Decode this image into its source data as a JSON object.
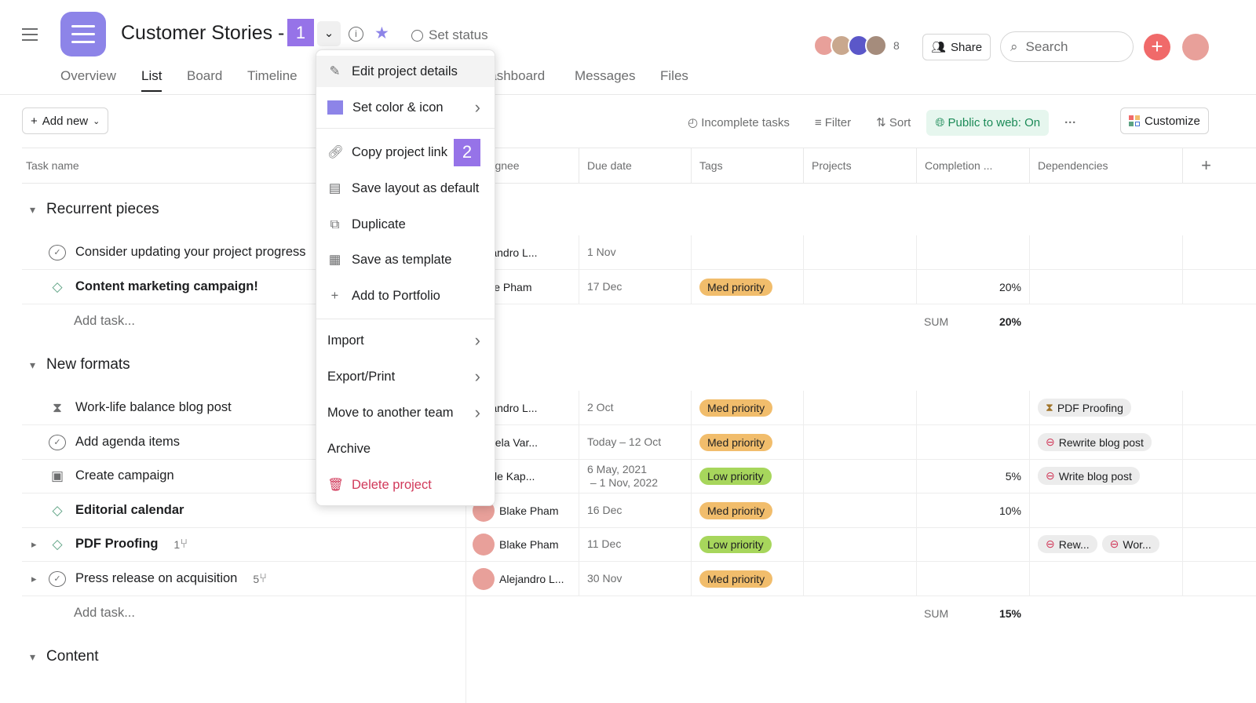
{
  "header": {
    "title": "Customer Stories - ",
    "badge1": "1",
    "set_status": "Set status",
    "member_count": "8",
    "share": "Share",
    "search_placeholder": "Search"
  },
  "tabs": [
    "Overview",
    "List",
    "Board",
    "Timeline",
    "Dashboard",
    "Messages",
    "Files"
  ],
  "toolbar": {
    "add_new": "Add new",
    "incomplete": "Incomplete tasks",
    "filter": "Filter",
    "sort": "Sort",
    "public": "Public to web: On",
    "more": "···",
    "customize": "Customize"
  },
  "columns": [
    "Task name",
    "Assignee",
    "Due date",
    "Tags",
    "Projects",
    "Completion ...",
    "Dependencies",
    "+"
  ],
  "colors": {
    "accent": "#8d84e8",
    "med": "#f1bd6c",
    "low": "#a7d65c",
    "public_bg": "#e6f6ee",
    "public_fg": "#1b8a57",
    "add_btn": "#f06a6a",
    "danger": "#d1395a"
  },
  "sections": [
    {
      "name": "Recurrent pieces",
      "rows": [
        {
          "icon": "check",
          "name": "Consider updating your project progress",
          "bold": false,
          "assignee": "Alejandro L...",
          "due": "1 Nov",
          "tag": "",
          "completion": "",
          "deps": []
        },
        {
          "icon": "diamond",
          "name": "Content marketing campaign!",
          "bold": true,
          "assignee": "Blake Pham",
          "due": "17 Dec",
          "tag": "Med priority",
          "completion": "20%",
          "deps": []
        }
      ],
      "add_task": "Add task...",
      "sum_label": "SUM",
      "sum": "20%"
    },
    {
      "name": "New formats",
      "rows": [
        {
          "icon": "hourglass",
          "name": "Work-life balance blog post",
          "bold": false,
          "assignee": "Alejandro L...",
          "due": "2 Oct",
          "tag": "Med priority",
          "completion": "",
          "deps": [
            {
              "icon": "hourglass",
              "label": "PDF Proofing"
            }
          ]
        },
        {
          "icon": "check",
          "name": "Add agenda items",
          "bold": false,
          "assignee": "Daniela Var...",
          "due": "Today – 12 Oct",
          "tag": "Med priority",
          "completion": "",
          "deps": [
            {
              "icon": "blocked",
              "label": "Rewrite blog post"
            }
          ]
        },
        {
          "icon": "approval",
          "name": "Create campaign",
          "bold": false,
          "assignee": "Nicole Kap...",
          "due": "6 May, 2021\n – 1 Nov, 2022",
          "tag": "Low priority",
          "completion": "5%",
          "deps": [
            {
              "icon": "blocked",
              "label": "Write blog post"
            }
          ]
        },
        {
          "icon": "diamond",
          "name": "Editorial calendar",
          "bold": true,
          "assignee": "Blake Pham",
          "due": "16 Dec",
          "tag": "Med priority",
          "completion": "10%",
          "deps": [],
          "avatar": true
        },
        {
          "icon": "diamond",
          "name": "PDF Proofing",
          "bold": true,
          "subtasks": "1",
          "expand": true,
          "assignee": "Blake Pham",
          "due": "11 Dec",
          "tag": "Low priority",
          "completion": "",
          "deps": [
            {
              "icon": "blocked",
              "label": "Rew..."
            },
            {
              "icon": "blocked",
              "label": "Wor..."
            }
          ],
          "avatar": true
        },
        {
          "icon": "check",
          "name": "Press release on acquisition",
          "bold": false,
          "subtasks": "5",
          "expand": true,
          "assignee": "Alejandro L...",
          "due": "30 Nov",
          "tag": "Med priority",
          "completion": "",
          "deps": [],
          "avatar": true
        }
      ],
      "add_task": "Add task...",
      "sum_label": "SUM",
      "sum": "15%"
    },
    {
      "name": "Content",
      "rows": []
    }
  ],
  "menu": {
    "items": [
      {
        "icon": "pencil",
        "label": "Edit project details"
      },
      {
        "icon": "color-square",
        "label": "Set color & icon",
        "submenu": true
      },
      {
        "icon": "link",
        "label": "Copy project link",
        "badge": "2"
      },
      {
        "icon": "save-layout",
        "label": "Save layout as default"
      },
      {
        "icon": "duplicate",
        "label": "Duplicate"
      },
      {
        "icon": "template",
        "label": "Save as template"
      },
      {
        "icon": "plus",
        "label": "Add to Portfolio"
      },
      {
        "label": "Import",
        "submenu": true
      },
      {
        "label": "Export/Print",
        "submenu": true
      },
      {
        "label": "Move to another team",
        "submenu": true
      },
      {
        "label": "Archive"
      },
      {
        "icon": "trash",
        "label": "Delete project",
        "danger": true
      }
    ]
  }
}
